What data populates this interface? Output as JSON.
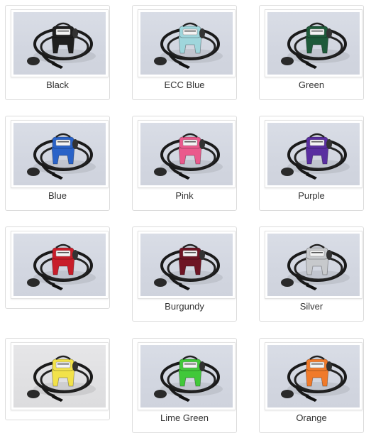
{
  "products": [
    {
      "label": "Black",
      "color": "#1f1f1f"
    },
    {
      "label": "ECC Blue",
      "color": "#9fd6dc"
    },
    {
      "label": "Green",
      "color": "#1e5a3a"
    },
    {
      "label": "Blue",
      "color": "#2a63c8"
    },
    {
      "label": "Pink",
      "color": "#ea5a8c"
    },
    {
      "label": "Purple",
      "color": "#5a2fa0"
    },
    {
      "label": "",
      "color": "#c81e2a"
    },
    {
      "label": "Burgundy",
      "color": "#6e1524"
    },
    {
      "label": "Silver",
      "color": "#c7c9cc"
    },
    {
      "label": "",
      "color": "#f2e24a"
    },
    {
      "label": "Lime Green",
      "color": "#41c83a"
    },
    {
      "label": "Orange",
      "color": "#f07a2a"
    }
  ]
}
